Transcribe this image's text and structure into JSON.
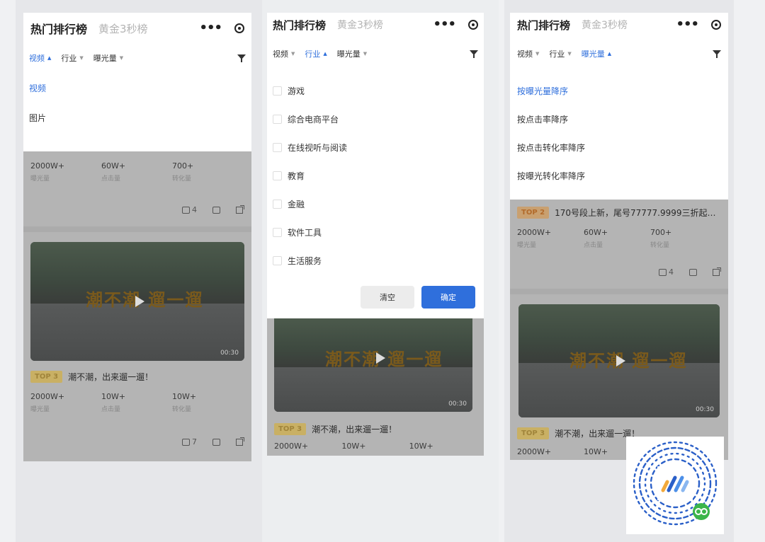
{
  "header": {
    "title": "热门排行榜",
    "subtitle": "黄金3秒榜"
  },
  "filters": {
    "video": "视频",
    "industry": "行业",
    "exposure": "曝光量"
  },
  "panel1": {
    "options": [
      "视频",
      "图片"
    ],
    "card1": {
      "stats": [
        {
          "v": "2000W+",
          "l": "曝光量"
        },
        {
          "v": "60W+",
          "l": "点击量"
        },
        {
          "v": "700+",
          "l": "转化量"
        }
      ],
      "likes": "4"
    },
    "card2": {
      "badge": "TOP 3",
      "title": "潮不潮，出来遛一遛！",
      "duration": "00:30",
      "stats": [
        {
          "v": "2000W+",
          "l": "曝光量"
        },
        {
          "v": "10W+",
          "l": "点击量"
        },
        {
          "v": "10W+",
          "l": "转化量"
        }
      ],
      "likes": "7"
    },
    "video_text": "潮不潮 遛一遛"
  },
  "panel2": {
    "options": [
      "游戏",
      "综合电商平台",
      "在线视听与阅读",
      "教育",
      "金融",
      "软件工具",
      "生活服务"
    ],
    "clear": "清空",
    "ok": "确定",
    "card": {
      "badge": "TOP 3",
      "title": "潮不潮，出来遛一遛！",
      "duration": "00:30",
      "stats": [
        "2000W+",
        "10W+",
        "10W+"
      ]
    },
    "video_text": "潮不潮 遛一遛"
  },
  "panel3": {
    "options": [
      "按曝光量降序",
      "按点击率降序",
      "按点击转化率降序",
      "按曝光转化率降序"
    ],
    "card1": {
      "badge": "TOP 2",
      "title": "170号段上新，尾号77777.9999三折起…",
      "stats": [
        {
          "v": "2000W+",
          "l": "曝光量"
        },
        {
          "v": "60W+",
          "l": "点击量"
        },
        {
          "v": "700+",
          "l": "转化量"
        }
      ],
      "likes": "4"
    },
    "card2": {
      "badge": "TOP 3",
      "title": "潮不潮，出来遛一遛！",
      "duration": "00:30",
      "stats": [
        "2000W+",
        "10W+"
      ]
    },
    "video_text": "潮不潮 遛一遛"
  }
}
